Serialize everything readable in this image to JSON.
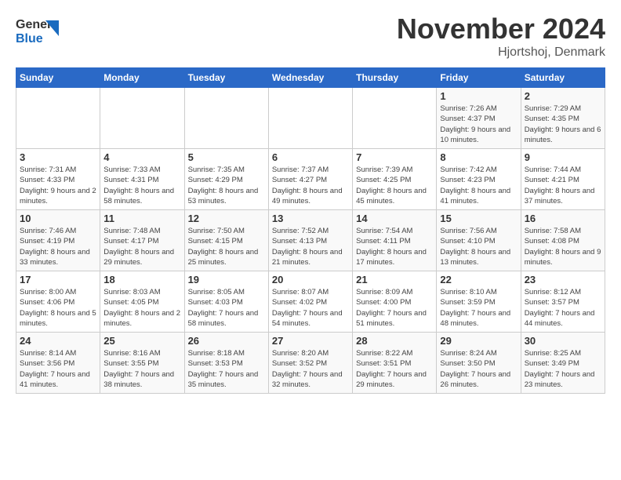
{
  "header": {
    "logo_general": "General",
    "logo_blue": "Blue",
    "month_title": "November 2024",
    "location": "Hjortshoj, Denmark"
  },
  "days_of_week": [
    "Sunday",
    "Monday",
    "Tuesday",
    "Wednesday",
    "Thursday",
    "Friday",
    "Saturday"
  ],
  "weeks": [
    [
      {
        "day": "",
        "sunrise": "",
        "sunset": "",
        "daylight": ""
      },
      {
        "day": "",
        "sunrise": "",
        "sunset": "",
        "daylight": ""
      },
      {
        "day": "",
        "sunrise": "",
        "sunset": "",
        "daylight": ""
      },
      {
        "day": "",
        "sunrise": "",
        "sunset": "",
        "daylight": ""
      },
      {
        "day": "",
        "sunrise": "",
        "sunset": "",
        "daylight": ""
      },
      {
        "day": "1",
        "sunrise": "Sunrise: 7:26 AM",
        "sunset": "Sunset: 4:37 PM",
        "daylight": "Daylight: 9 hours and 10 minutes."
      },
      {
        "day": "2",
        "sunrise": "Sunrise: 7:29 AM",
        "sunset": "Sunset: 4:35 PM",
        "daylight": "Daylight: 9 hours and 6 minutes."
      }
    ],
    [
      {
        "day": "3",
        "sunrise": "Sunrise: 7:31 AM",
        "sunset": "Sunset: 4:33 PM",
        "daylight": "Daylight: 9 hours and 2 minutes."
      },
      {
        "day": "4",
        "sunrise": "Sunrise: 7:33 AM",
        "sunset": "Sunset: 4:31 PM",
        "daylight": "Daylight: 8 hours and 58 minutes."
      },
      {
        "day": "5",
        "sunrise": "Sunrise: 7:35 AM",
        "sunset": "Sunset: 4:29 PM",
        "daylight": "Daylight: 8 hours and 53 minutes."
      },
      {
        "day": "6",
        "sunrise": "Sunrise: 7:37 AM",
        "sunset": "Sunset: 4:27 PM",
        "daylight": "Daylight: 8 hours and 49 minutes."
      },
      {
        "day": "7",
        "sunrise": "Sunrise: 7:39 AM",
        "sunset": "Sunset: 4:25 PM",
        "daylight": "Daylight: 8 hours and 45 minutes."
      },
      {
        "day": "8",
        "sunrise": "Sunrise: 7:42 AM",
        "sunset": "Sunset: 4:23 PM",
        "daylight": "Daylight: 8 hours and 41 minutes."
      },
      {
        "day": "9",
        "sunrise": "Sunrise: 7:44 AM",
        "sunset": "Sunset: 4:21 PM",
        "daylight": "Daylight: 8 hours and 37 minutes."
      }
    ],
    [
      {
        "day": "10",
        "sunrise": "Sunrise: 7:46 AM",
        "sunset": "Sunset: 4:19 PM",
        "daylight": "Daylight: 8 hours and 33 minutes."
      },
      {
        "day": "11",
        "sunrise": "Sunrise: 7:48 AM",
        "sunset": "Sunset: 4:17 PM",
        "daylight": "Daylight: 8 hours and 29 minutes."
      },
      {
        "day": "12",
        "sunrise": "Sunrise: 7:50 AM",
        "sunset": "Sunset: 4:15 PM",
        "daylight": "Daylight: 8 hours and 25 minutes."
      },
      {
        "day": "13",
        "sunrise": "Sunrise: 7:52 AM",
        "sunset": "Sunset: 4:13 PM",
        "daylight": "Daylight: 8 hours and 21 minutes."
      },
      {
        "day": "14",
        "sunrise": "Sunrise: 7:54 AM",
        "sunset": "Sunset: 4:11 PM",
        "daylight": "Daylight: 8 hours and 17 minutes."
      },
      {
        "day": "15",
        "sunrise": "Sunrise: 7:56 AM",
        "sunset": "Sunset: 4:10 PM",
        "daylight": "Daylight: 8 hours and 13 minutes."
      },
      {
        "day": "16",
        "sunrise": "Sunrise: 7:58 AM",
        "sunset": "Sunset: 4:08 PM",
        "daylight": "Daylight: 8 hours and 9 minutes."
      }
    ],
    [
      {
        "day": "17",
        "sunrise": "Sunrise: 8:00 AM",
        "sunset": "Sunset: 4:06 PM",
        "daylight": "Daylight: 8 hours and 5 minutes."
      },
      {
        "day": "18",
        "sunrise": "Sunrise: 8:03 AM",
        "sunset": "Sunset: 4:05 PM",
        "daylight": "Daylight: 8 hours and 2 minutes."
      },
      {
        "day": "19",
        "sunrise": "Sunrise: 8:05 AM",
        "sunset": "Sunset: 4:03 PM",
        "daylight": "Daylight: 7 hours and 58 minutes."
      },
      {
        "day": "20",
        "sunrise": "Sunrise: 8:07 AM",
        "sunset": "Sunset: 4:02 PM",
        "daylight": "Daylight: 7 hours and 54 minutes."
      },
      {
        "day": "21",
        "sunrise": "Sunrise: 8:09 AM",
        "sunset": "Sunset: 4:00 PM",
        "daylight": "Daylight: 7 hours and 51 minutes."
      },
      {
        "day": "22",
        "sunrise": "Sunrise: 8:10 AM",
        "sunset": "Sunset: 3:59 PM",
        "daylight": "Daylight: 7 hours and 48 minutes."
      },
      {
        "day": "23",
        "sunrise": "Sunrise: 8:12 AM",
        "sunset": "Sunset: 3:57 PM",
        "daylight": "Daylight: 7 hours and 44 minutes."
      }
    ],
    [
      {
        "day": "24",
        "sunrise": "Sunrise: 8:14 AM",
        "sunset": "Sunset: 3:56 PM",
        "daylight": "Daylight: 7 hours and 41 minutes."
      },
      {
        "day": "25",
        "sunrise": "Sunrise: 8:16 AM",
        "sunset": "Sunset: 3:55 PM",
        "daylight": "Daylight: 7 hours and 38 minutes."
      },
      {
        "day": "26",
        "sunrise": "Sunrise: 8:18 AM",
        "sunset": "Sunset: 3:53 PM",
        "daylight": "Daylight: 7 hours and 35 minutes."
      },
      {
        "day": "27",
        "sunrise": "Sunrise: 8:20 AM",
        "sunset": "Sunset: 3:52 PM",
        "daylight": "Daylight: 7 hours and 32 minutes."
      },
      {
        "day": "28",
        "sunrise": "Sunrise: 8:22 AM",
        "sunset": "Sunset: 3:51 PM",
        "daylight": "Daylight: 7 hours and 29 minutes."
      },
      {
        "day": "29",
        "sunrise": "Sunrise: 8:24 AM",
        "sunset": "Sunset: 3:50 PM",
        "daylight": "Daylight: 7 hours and 26 minutes."
      },
      {
        "day": "30",
        "sunrise": "Sunrise: 8:25 AM",
        "sunset": "Sunset: 3:49 PM",
        "daylight": "Daylight: 7 hours and 23 minutes."
      }
    ]
  ]
}
